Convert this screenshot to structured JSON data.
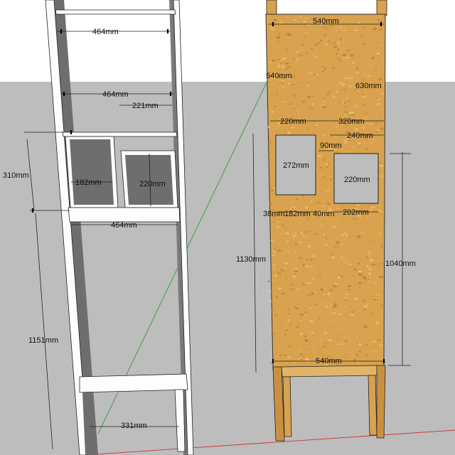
{
  "colors": {
    "sky": "#ffffff",
    "ground": "#bdbdbd",
    "frame_white": "#fdfdfd",
    "frame_shadow": "#6e6e6e",
    "board": "#d9a24e",
    "board_dark": "#b27c33",
    "red_axis": "#cc3333",
    "green_axis": "#3a9a3a"
  },
  "left_model": {
    "dims": {
      "top_width": "464mm",
      "upper_width": "464mm",
      "small_shelf": "221mm",
      "upper_height": "310mm",
      "box_a_width": "182mm",
      "box_b_height": "220mm",
      "lower_width": "464mm",
      "total_height": "1151mm",
      "base_width": "331mm"
    }
  },
  "right_model": {
    "dims": {
      "top_width": "540mm",
      "side_offset": "540mm",
      "panel_height": "630mm",
      "opening_left_offset": "220mm",
      "opening_span": "320mm",
      "opening_right_width": "240mm",
      "gap_between": "90mm",
      "opening_a_height": "272mm",
      "opening_b_height": "220mm",
      "margin_left": "38mm",
      "opening_a_width": "182mm",
      "gap_bottom": "40mm",
      "opening_b_width": "202mm",
      "left_height": "1130mm",
      "right_height": "1040mm",
      "bottom_width": "540mm"
    }
  }
}
